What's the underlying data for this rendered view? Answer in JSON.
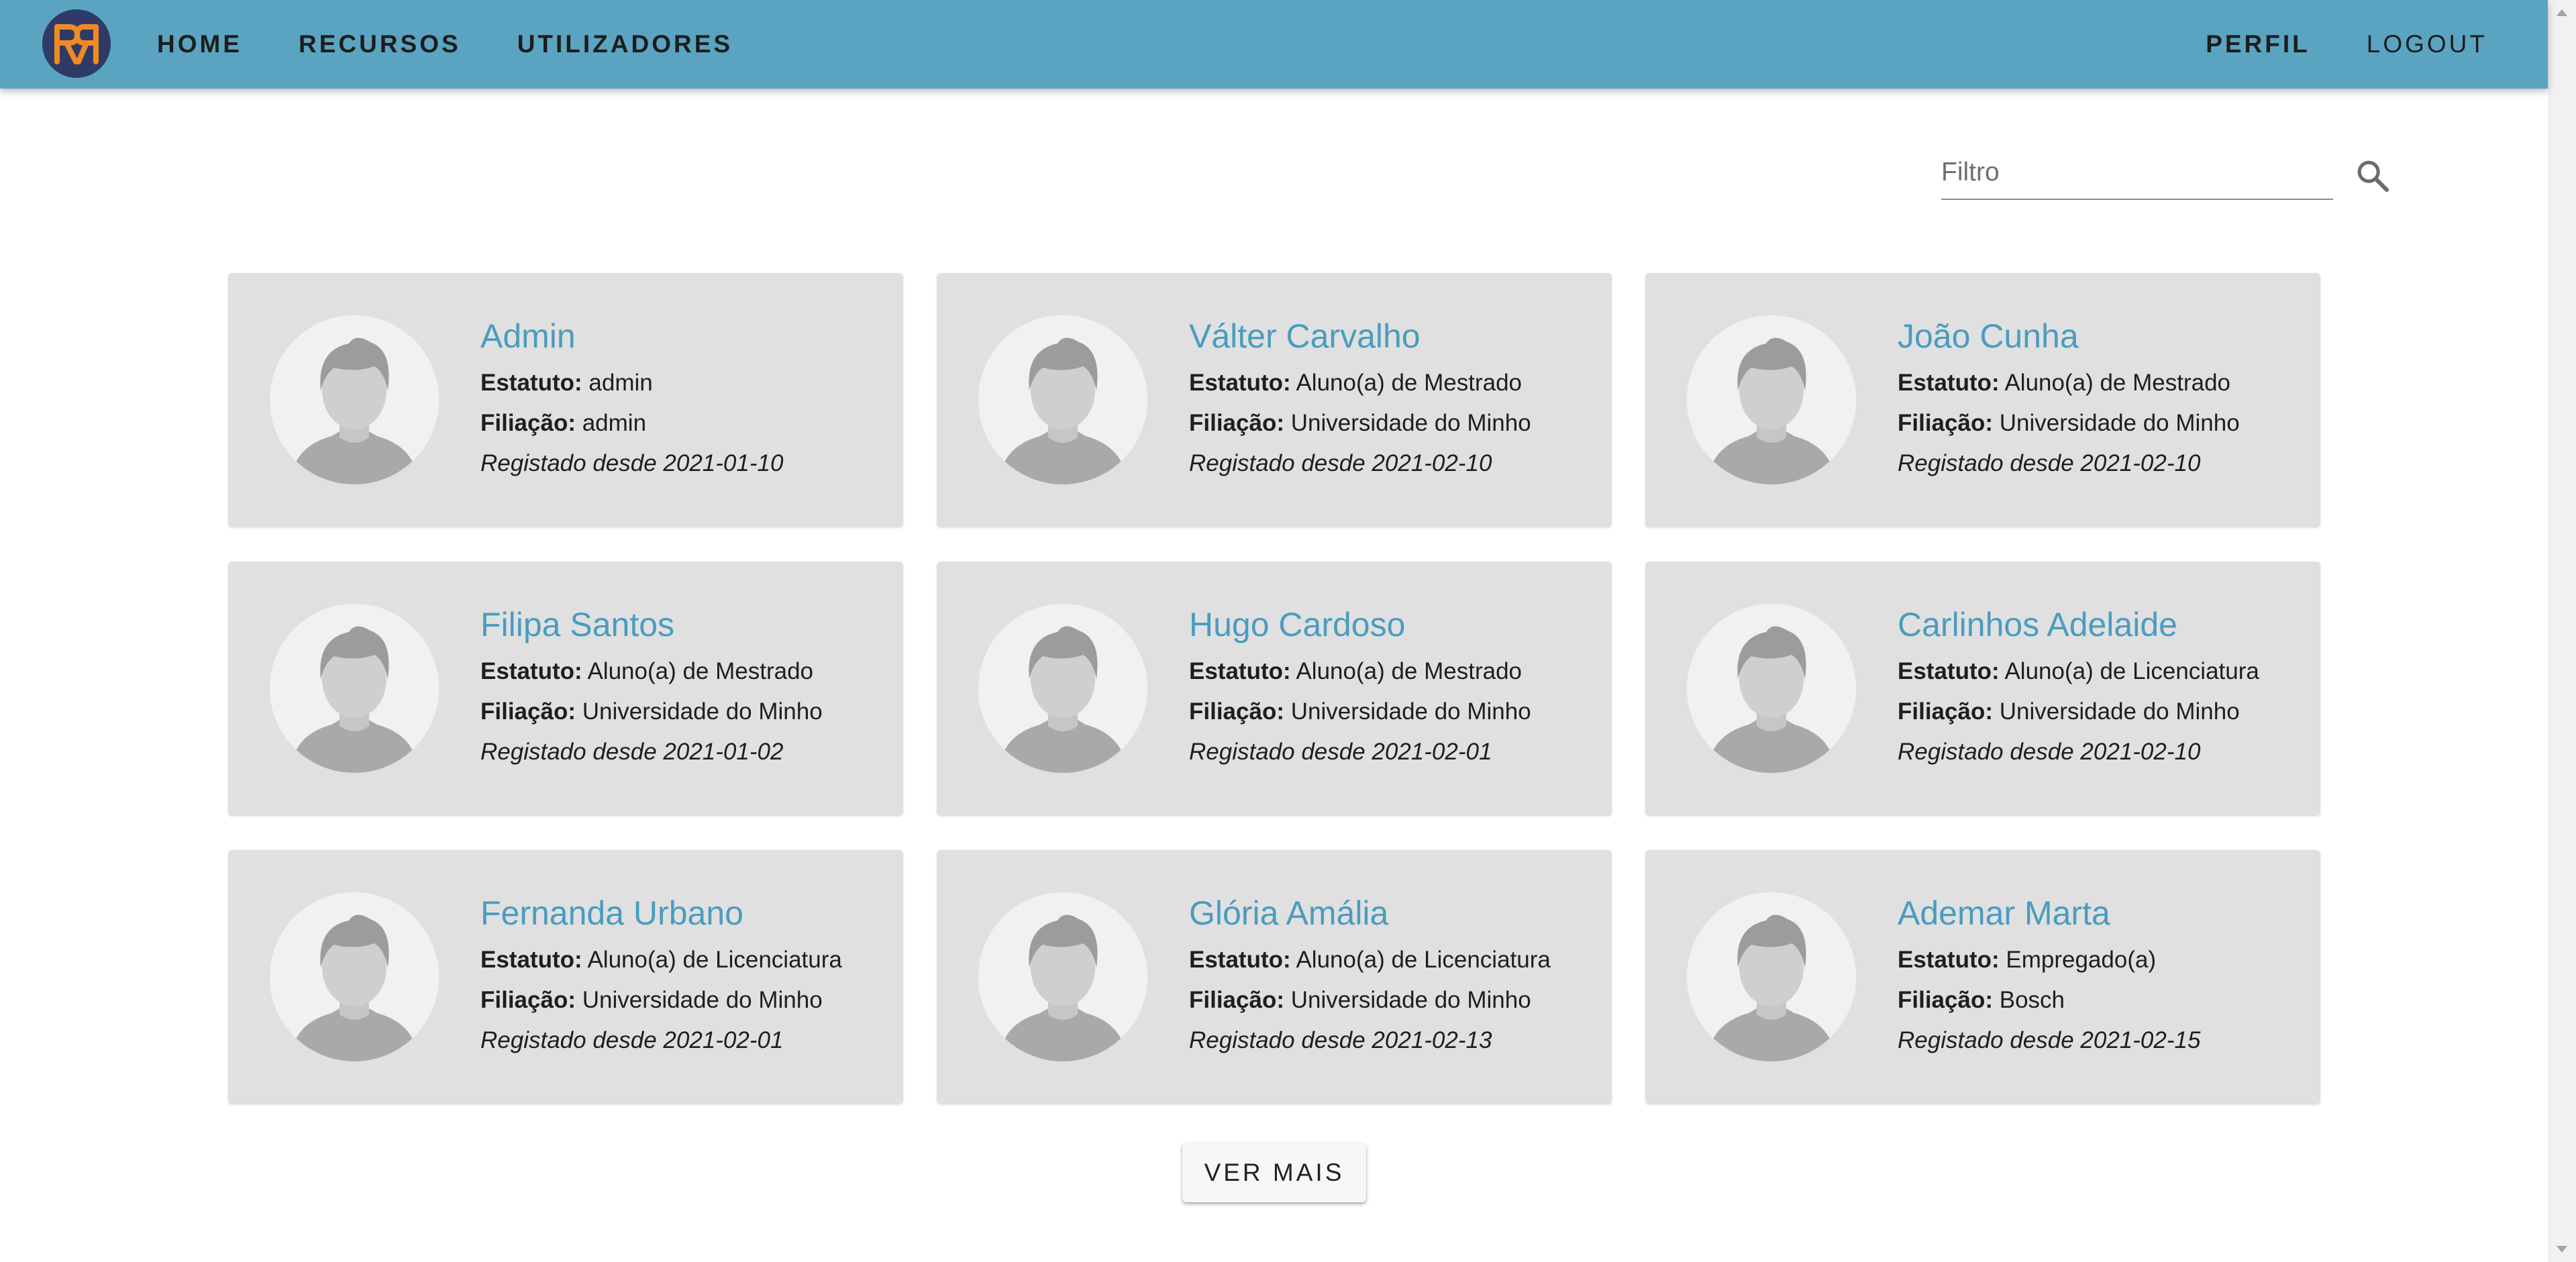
{
  "nav": {
    "logo_text": "RR",
    "left_links": [
      "HOME",
      "RECURSOS",
      "UTILIZADORES"
    ],
    "right_links": [
      "PERFIL",
      "LOGOUT"
    ]
  },
  "search": {
    "placeholder": "Filtro",
    "value": ""
  },
  "labels": {
    "estatuto": "Estatuto:",
    "filiacao": "Filiação:"
  },
  "users": [
    {
      "name": "Admin",
      "estatuto": "admin",
      "filiacao": "admin",
      "registado": "Registado desde 2021-01-10"
    },
    {
      "name": "Válter Carvalho",
      "estatuto": "Aluno(a) de Mestrado",
      "filiacao": "Universidade do Minho",
      "registado": "Registado desde 2021-02-10"
    },
    {
      "name": "João Cunha",
      "estatuto": "Aluno(a) de Mestrado",
      "filiacao": "Universidade do Minho",
      "registado": "Registado desde 2021-02-10"
    },
    {
      "name": "Filipa Santos",
      "estatuto": "Aluno(a) de Mestrado",
      "filiacao": "Universidade do Minho",
      "registado": "Registado desde 2021-01-02"
    },
    {
      "name": "Hugo Cardoso",
      "estatuto": "Aluno(a) de Mestrado",
      "filiacao": "Universidade do Minho",
      "registado": "Registado desde 2021-02-01"
    },
    {
      "name": "Carlinhos Adelaide",
      "estatuto": "Aluno(a) de Licenciatura",
      "filiacao": "Universidade do Minho",
      "registado": "Registado desde 2021-02-10"
    },
    {
      "name": "Fernanda Urbano",
      "estatuto": "Aluno(a) de Licenciatura",
      "filiacao": "Universidade do Minho",
      "registado": "Registado desde 2021-02-01"
    },
    {
      "name": "Glória Amália",
      "estatuto": "Aluno(a) de Licenciatura",
      "filiacao": "Universidade do Minho",
      "registado": "Registado desde 2021-02-13"
    },
    {
      "name": "Ademar Marta",
      "estatuto": "Empregado(a)",
      "filiacao": "Bosch",
      "registado": "Registado desde 2021-02-15"
    }
  ],
  "more_button": "VER MAIS",
  "colors": {
    "appbar": "#5aa4c2",
    "name_link": "#4a9cbf",
    "card_bg": "#e0e0e0",
    "logo_bg": "#2f3b66",
    "logo_letters": "#f08a24"
  }
}
